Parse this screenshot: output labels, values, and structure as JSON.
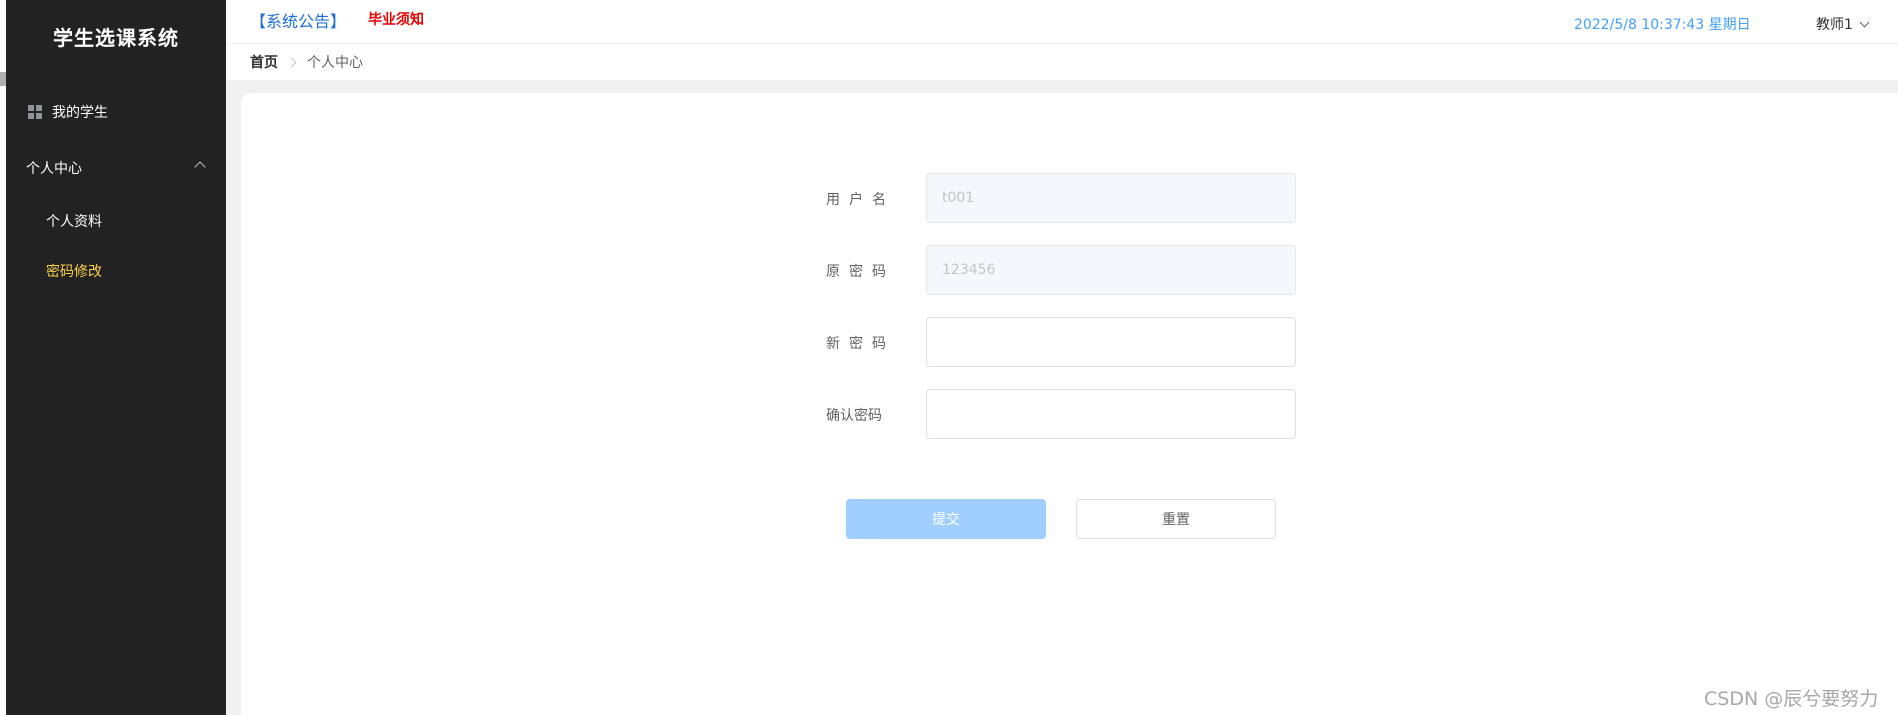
{
  "app": {
    "title": "学生选课系统"
  },
  "sidebar": {
    "items": [
      {
        "label": "我的学生",
        "icon": "grid-icon"
      }
    ],
    "submenu": {
      "label": "个人中心",
      "items": [
        {
          "label": "个人资料",
          "active": false
        },
        {
          "label": "密码修改",
          "active": true
        }
      ]
    },
    "background": "#222222",
    "active_color": "#ffd04b"
  },
  "header": {
    "notice_link": "【系统公告】",
    "graduation_link": "毕业须知",
    "datetime": "2022/5/8 10:37:43 星期日",
    "user": "教师1"
  },
  "breadcrumb": {
    "home": "首页",
    "current": "个人中心"
  },
  "form": {
    "username": {
      "label": "用户名",
      "value": "t001"
    },
    "old_password": {
      "label": "原密码",
      "value": "123456"
    },
    "new_password": {
      "label": "新密码",
      "value": ""
    },
    "confirm_password": {
      "label": "确认密码",
      "value": ""
    },
    "submit_label": "提交",
    "reset_label": "重置"
  },
  "watermark": "CSDN @辰兮要努力"
}
